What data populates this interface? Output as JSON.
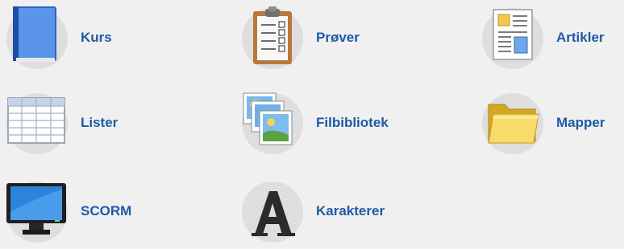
{
  "tiles": [
    {
      "label": "Kurs",
      "icon": "book-icon"
    },
    {
      "label": "Prøver",
      "icon": "clipboard-icon"
    },
    {
      "label": "Artikler",
      "icon": "article-icon"
    },
    {
      "label": "Lister",
      "icon": "table-icon"
    },
    {
      "label": "Filbibliotek",
      "icon": "pictures-icon"
    },
    {
      "label": "Mapper",
      "icon": "folder-icon"
    },
    {
      "label": "SCORM",
      "icon": "monitor-icon"
    },
    {
      "label": "Karakterer",
      "icon": "letter-a-icon"
    }
  ],
  "colors": {
    "background": "#f0f0f0",
    "circle": "#dedede",
    "label": "#1e5aa8"
  }
}
